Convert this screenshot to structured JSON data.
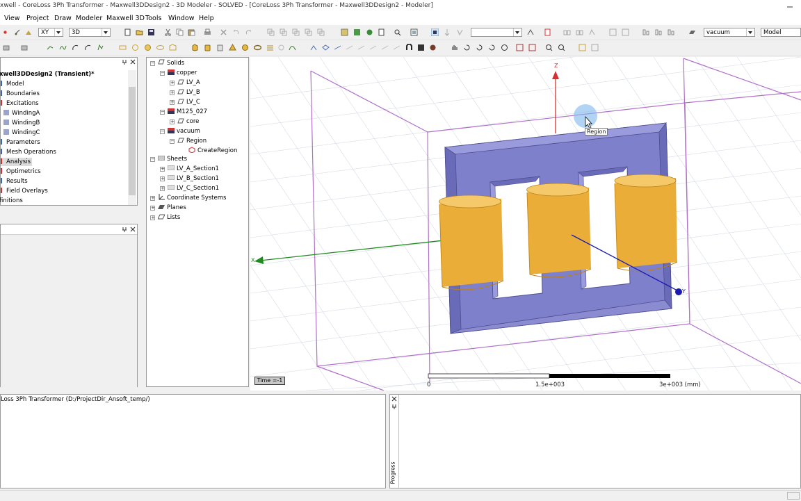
{
  "window": {
    "title": "xwell - CoreLoss 3Ph Transformer - Maxwell3DDesign2 - 3D Modeler - SOLVED - [CoreLoss 3Ph Transformer - Maxwell3DDesign2 - Modeler]"
  },
  "menu": {
    "items": [
      "View",
      "Project",
      "Draw",
      "Modeler",
      "Maxwell 3D",
      "Tools",
      "Window",
      "Help"
    ]
  },
  "toolbar": {
    "plane_value": "XY",
    "mode_value": "3D",
    "blank_combo_value": "",
    "material_value": "vacuum",
    "model_value": "Model"
  },
  "project_tree": {
    "root": "xwell3DDesign2 (Transient)*",
    "items": [
      "Model",
      "Boundaries",
      "Excitations",
      "WindingA",
      "WindingB",
      "WindingC",
      "Parameters",
      "Mesh Operations",
      "Analysis",
      "Optimetrics",
      "Results",
      "Field Overlays",
      "finitions"
    ]
  },
  "model_tree": {
    "solids": "Solids",
    "copper": "copper",
    "lv_a": "LV_A",
    "lv_b": "LV_B",
    "lv_c": "LV_C",
    "m125": "M125_027",
    "core": "core",
    "vacuum": "vacuum",
    "region": "Region",
    "create_region": "CreateRegion",
    "sheets": "Sheets",
    "sheet1": "LV_A_Section1",
    "sheet2": "LV_B_Section1",
    "sheet3": "LV_C_Section1",
    "coord": "Coordinate Systems",
    "planes": "Planes",
    "lists": "Lists"
  },
  "viewport": {
    "tooltip": "Region",
    "time_label": "Time =-1",
    "ruler": {
      "start": "0",
      "mid": "1.5e+003",
      "end": "3e+003 (mm)"
    },
    "axes": {
      "z": "Z",
      "x": "X",
      "y": "Y"
    }
  },
  "message_panel": {
    "text": "Loss 3Ph Transformer (D:/ProjectDir_Ansoft_temp/)"
  },
  "progress_panel": {
    "label": "Progress"
  },
  "colors": {
    "core": "#7f80cc",
    "coil": "#e9ad38",
    "region_box": "#b070c8",
    "grid": "#d6dce6"
  }
}
